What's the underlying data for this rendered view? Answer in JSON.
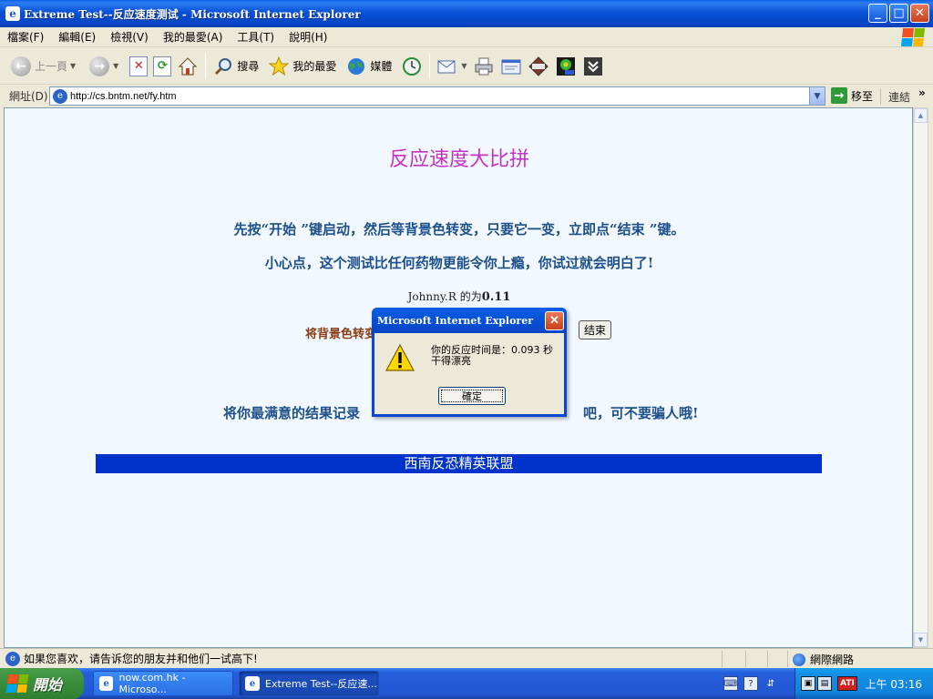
{
  "window": {
    "title": "Extreme Test--反应速度测试 - Microsoft Internet Explorer",
    "icon": "ie-icon",
    "controls": {
      "minimize": "_",
      "maximize": "□",
      "close": "✕"
    }
  },
  "menu": {
    "items": [
      "檔案(F)",
      "編輯(E)",
      "檢視(V)",
      "我的最愛(A)",
      "工具(T)",
      "說明(H)"
    ]
  },
  "toolbar": {
    "back": "上一頁",
    "search": "搜尋",
    "favorites": "我的最愛",
    "media": "媒體"
  },
  "address": {
    "label": "網址(D)",
    "url": "http://cs.bntm.net/fy.htm",
    "go": "移至",
    "links": "連結",
    "more": "»"
  },
  "page": {
    "heading": "反应速度大比拼",
    "instruction1": "先按“开始 ”键启动，然后等背景色转变，只要它一变，立即点“结束 ”键。",
    "instruction2": "小心点，这个测试比任何药物更能令你上瘾，你试过就会明白了!",
    "score_name": "Johnny.R 的为",
    "score_value": "0.11",
    "change_label": "将背景色转变",
    "end_button": "结束",
    "record_left": "将你最满意的结果记录",
    "record_right": "吧，可不要骗人哦!",
    "banner": "西南反恐精英联盟"
  },
  "dialog": {
    "title": "Microsoft Internet Explorer",
    "message_line1": "你的反应时间是：0.093 秒",
    "message_line2": "干得漂亮",
    "ok": "確定"
  },
  "status": {
    "text": "如果您喜欢，请告诉您的朋友并和他们一试高下!",
    "zone": "網際網路"
  },
  "taskbar": {
    "start": "開始",
    "tasks": [
      "now.com.hk - Microso...",
      "Extreme Test--反应速..."
    ],
    "clock": "上午 03:16"
  }
}
